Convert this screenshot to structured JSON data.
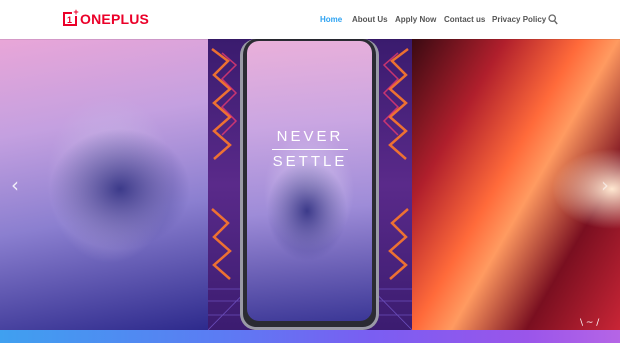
{
  "brand": {
    "logo_text": "ONEPLUS",
    "logo_mark": "1",
    "logo_plus": "+",
    "color": "#eb0029"
  },
  "nav": {
    "items": [
      {
        "label": "Home",
        "active": true
      },
      {
        "label": "About Us",
        "active": false
      },
      {
        "label": "Apply Now",
        "active": false
      },
      {
        "label": "Contact us",
        "active": false
      },
      {
        "label": "Privacy Policy",
        "active": false
      }
    ],
    "active_color": "#2ea3f2",
    "search_icon": "search-icon"
  },
  "hero": {
    "tagline_line1": "NEVER",
    "tagline_line2": "SETTLE",
    "prev_icon": "‹",
    "next_icon": "›"
  },
  "strip": {
    "deco": "\\ ~ /"
  }
}
